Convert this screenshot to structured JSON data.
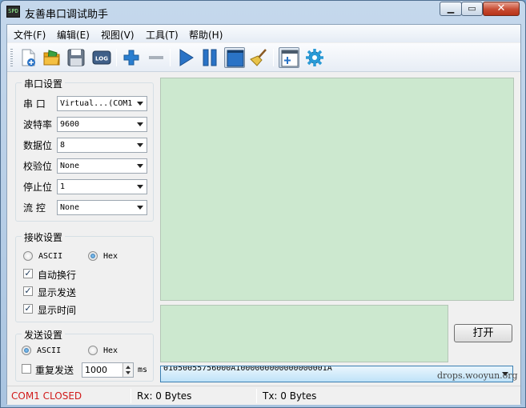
{
  "window": {
    "title": "友善串口调试助手",
    "icon_text": "SPD",
    "minimize_glyph": "▁",
    "maximize_glyph": "▭",
    "close_glyph": "✕"
  },
  "menu": [
    "文件(F)",
    "编辑(E)",
    "视图(V)",
    "工具(T)",
    "帮助(H)"
  ],
  "toolbar": {
    "icons": [
      "new-file-icon",
      "open-folder-icon",
      "save-icon",
      "log-icon",
      "add-icon",
      "remove-icon",
      "play-icon",
      "pause-icon",
      "window-icon",
      "broom-icon",
      "panel-add-icon",
      "gear-icon"
    ],
    "log_label": "LOG",
    "colors": {
      "blue": "#2a73c6",
      "gold": "#e8a516"
    }
  },
  "serial_settings": {
    "title": "串口设置",
    "rows": [
      {
        "label": "串 口",
        "value": "Virtual...(COM1"
      },
      {
        "label": "波特率",
        "value": "9600"
      },
      {
        "label": "数据位",
        "value": "8"
      },
      {
        "label": "校验位",
        "value": "None"
      },
      {
        "label": "停止位",
        "value": "1"
      },
      {
        "label": "流 控",
        "value": "None"
      }
    ]
  },
  "receive_settings": {
    "title": "接收设置",
    "ascii_label": "ASCII",
    "hex_label": "Hex",
    "selected": "Hex",
    "options": [
      {
        "label": "自动换行",
        "checked": true
      },
      {
        "label": "显示发送",
        "checked": true
      },
      {
        "label": "显示时间",
        "checked": true
      }
    ]
  },
  "send_settings": {
    "title": "发送设置",
    "ascii_label": "ASCII",
    "hex_label": "Hex",
    "selected": "ASCII",
    "repeat_label": "重复发送",
    "repeat_checked": false,
    "interval_value": "1000",
    "interval_unit": "ms"
  },
  "open_button": "打开",
  "history_value": "01050055756000A1000000000000000001A",
  "status": {
    "port": "COM1 CLOSED",
    "rx": "Rx: 0 Bytes",
    "tx": "Tx: 0 Bytes",
    "port_color": "#d11a1a"
  },
  "watermark": "drops.wooyun.org"
}
